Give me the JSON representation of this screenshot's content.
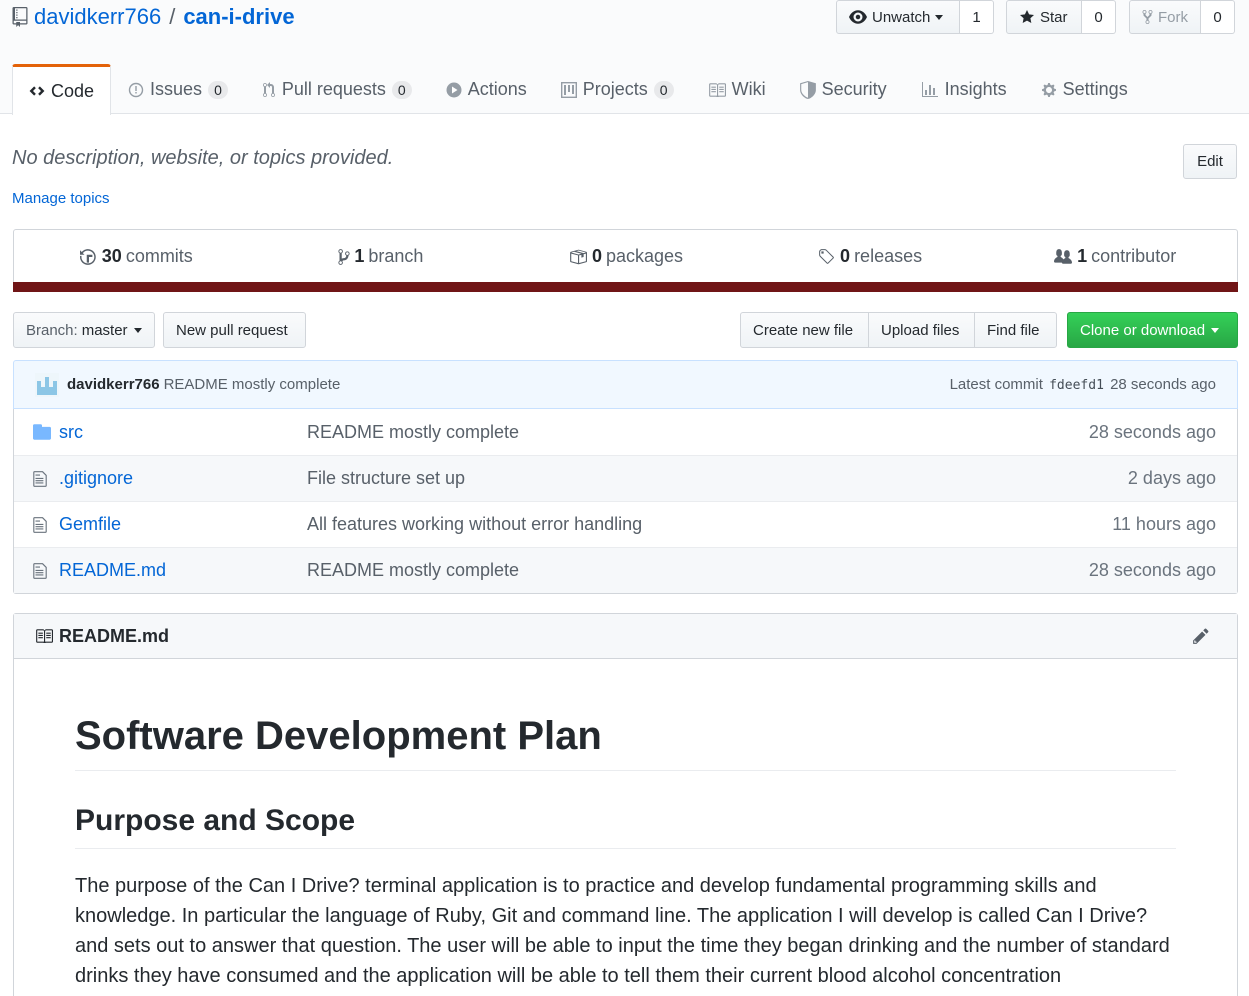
{
  "repo": {
    "owner": "davidkerr766",
    "separator": "/",
    "name": "can-i-drive"
  },
  "actions": {
    "watch": {
      "label": "Unwatch",
      "count": "1"
    },
    "star": {
      "label": "Star",
      "count": "0"
    },
    "fork": {
      "label": "Fork",
      "count": "0"
    }
  },
  "tabs": [
    {
      "label": "Code"
    },
    {
      "label": "Issues",
      "count": "0"
    },
    {
      "label": "Pull requests",
      "count": "0"
    },
    {
      "label": "Actions"
    },
    {
      "label": "Projects",
      "count": "0"
    },
    {
      "label": "Wiki"
    },
    {
      "label": "Security"
    },
    {
      "label": "Insights"
    },
    {
      "label": "Settings"
    }
  ],
  "about": {
    "description": "No description, website, or topics provided.",
    "edit_label": "Edit",
    "manage_topics": "Manage topics"
  },
  "summary": {
    "commits": {
      "count": "30",
      "label": "commits"
    },
    "branches": {
      "count": "1",
      "label": "branch"
    },
    "packages": {
      "count": "0",
      "label": "packages"
    },
    "releases": {
      "count": "0",
      "label": "releases"
    },
    "contributors": {
      "count": "1",
      "label": "contributor"
    },
    "language_color": "#701516"
  },
  "file_nav": {
    "branch_prefix": "Branch:",
    "branch": "master",
    "new_pr": "New pull request",
    "create_file": "Create new file",
    "upload": "Upload files",
    "find": "Find file",
    "clone": "Clone or download"
  },
  "latest_commit": {
    "author": "davidkerr766",
    "message": "README mostly complete",
    "label": "Latest commit",
    "sha": "fdeefd1",
    "age": "28 seconds ago"
  },
  "files": [
    {
      "icon": "folder-icon",
      "name": "src",
      "message": "README mostly complete",
      "age": "28 seconds ago"
    },
    {
      "icon": "file-icon",
      "name": ".gitignore",
      "message": "File structure set up",
      "age": "2 days ago"
    },
    {
      "icon": "file-icon",
      "name": "Gemfile",
      "message": "All features working without error handling",
      "age": "11 hours ago"
    },
    {
      "icon": "file-icon",
      "name": "README.md",
      "message": "README mostly complete",
      "age": "28 seconds ago"
    }
  ],
  "readme": {
    "filename": "README.md",
    "h1": "Software Development Plan",
    "h2": "Purpose and Scope",
    "paragraph": "The purpose of the Can I Drive? terminal application is to practice and develop fundamental programming skills and knowledge. In particular the language of Ruby, Git and command line. The application I will develop is called Can I Drive? and sets out to answer that question. The user will be able to input the time they began drinking and the number of standard drinks they have consumed and the application will be able to tell them their current blood alcohol concentration"
  }
}
